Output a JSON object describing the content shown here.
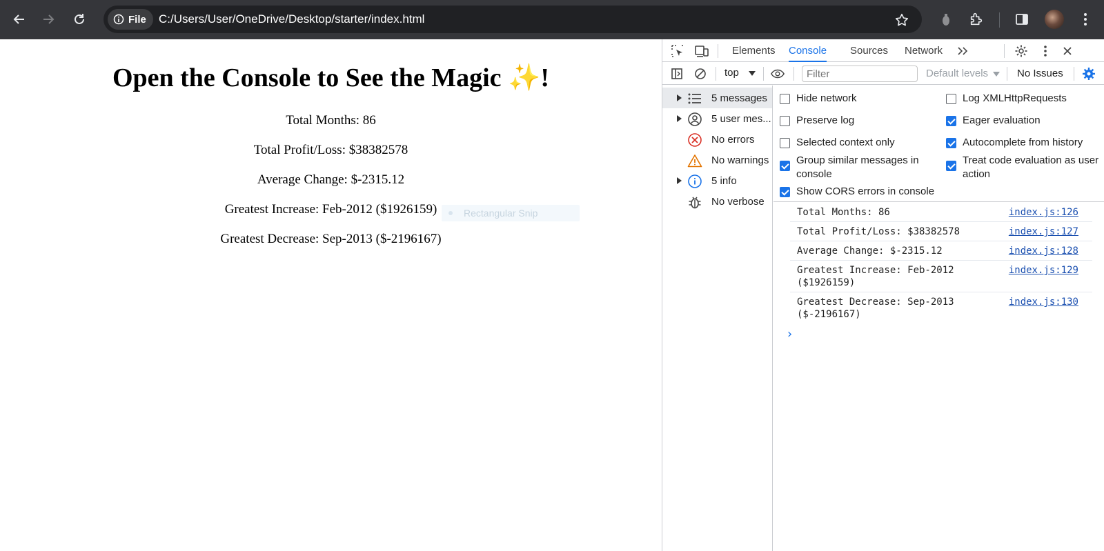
{
  "browser": {
    "site_chip": "File",
    "url": "C:/Users/User/OneDrive/Desktop/starter/index.html"
  },
  "page": {
    "heading": "Open the Console to See the Magic ✨!",
    "lines": [
      "Total Months: 86",
      "Total Profit/Loss: $38382578",
      "Average Change: $-2315.12",
      "Greatest Increase: Feb-2012 ($1926159)",
      "Greatest Decrease: Sep-2013 ($-2196167)"
    ],
    "snip_overlay": "Rectangular Snip"
  },
  "devtools": {
    "tabs": [
      "Elements",
      "Console",
      "Sources",
      "Network"
    ],
    "active_tab": "Console",
    "context": "top",
    "filter_placeholder": "Filter",
    "levels": "Default levels",
    "issues": "No Issues",
    "sidebar": [
      {
        "label": "5 messages",
        "icon": "list-icon"
      },
      {
        "label": "5 user mes...",
        "icon": "user-icon"
      },
      {
        "label": "No errors",
        "icon": "error-icon"
      },
      {
        "label": "No warnings",
        "icon": "warning-icon"
      },
      {
        "label": "5 info",
        "icon": "info-icon"
      },
      {
        "label": "No verbose",
        "icon": "bug-icon"
      }
    ],
    "settings": {
      "hide_network": "Hide network",
      "preserve_log": "Preserve log",
      "selected_context": "Selected context only",
      "group_similar": "Group similar messages in console",
      "show_cors": "Show CORS errors in console",
      "log_xhr": "Log XMLHttpRequests",
      "eager_eval": "Eager evaluation",
      "autocomplete": "Autocomplete from history",
      "treat_code": "Treat code evaluation as user action"
    },
    "messages": [
      {
        "text": "Total Months: 86",
        "source": "index.js:126"
      },
      {
        "text": "Total Profit/Loss: $38382578",
        "source": "index.js:127"
      },
      {
        "text": "Average Change: $-2315.12",
        "source": "index.js:128"
      },
      {
        "text": "Greatest Increase: Feb-2012 ($1926159)",
        "source": "index.js:129"
      },
      {
        "text": "Greatest Decrease: Sep-2013 ($-2196167)",
        "source": "index.js:130"
      }
    ],
    "prompt": "›"
  },
  "colors": {
    "accent": "#1a73e8",
    "chrome_bg": "#35363a",
    "omnibox_bg": "#202124"
  }
}
